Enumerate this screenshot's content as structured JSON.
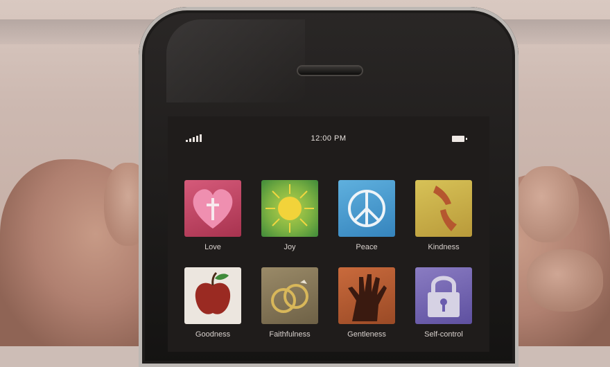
{
  "status_bar": {
    "time": "12:00 PM",
    "signal_icon": "signal-bars-icon",
    "battery_icon": "battery-icon"
  },
  "apps": [
    {
      "label": "Love",
      "icon": "heart-cross-icon",
      "color": "#c64a6a"
    },
    {
      "label": "Joy",
      "icon": "sun-icon",
      "color": "#7fb343"
    },
    {
      "label": "Peace",
      "icon": "peace-sign-icon",
      "color": "#4c9fd0"
    },
    {
      "label": "Kindness",
      "icon": "hands-icon",
      "color": "#c9b04a"
    },
    {
      "label": "Goodness",
      "icon": "apple-icon",
      "color": "#e8e2da"
    },
    {
      "label": "Faithfulness",
      "icon": "rings-icon",
      "color": "#8a7a5a"
    },
    {
      "label": "Gentleness",
      "icon": "hand-icon",
      "color": "#b85c34"
    },
    {
      "label": "Self-control",
      "icon": "padlock-icon",
      "color": "#7668b0"
    }
  ]
}
